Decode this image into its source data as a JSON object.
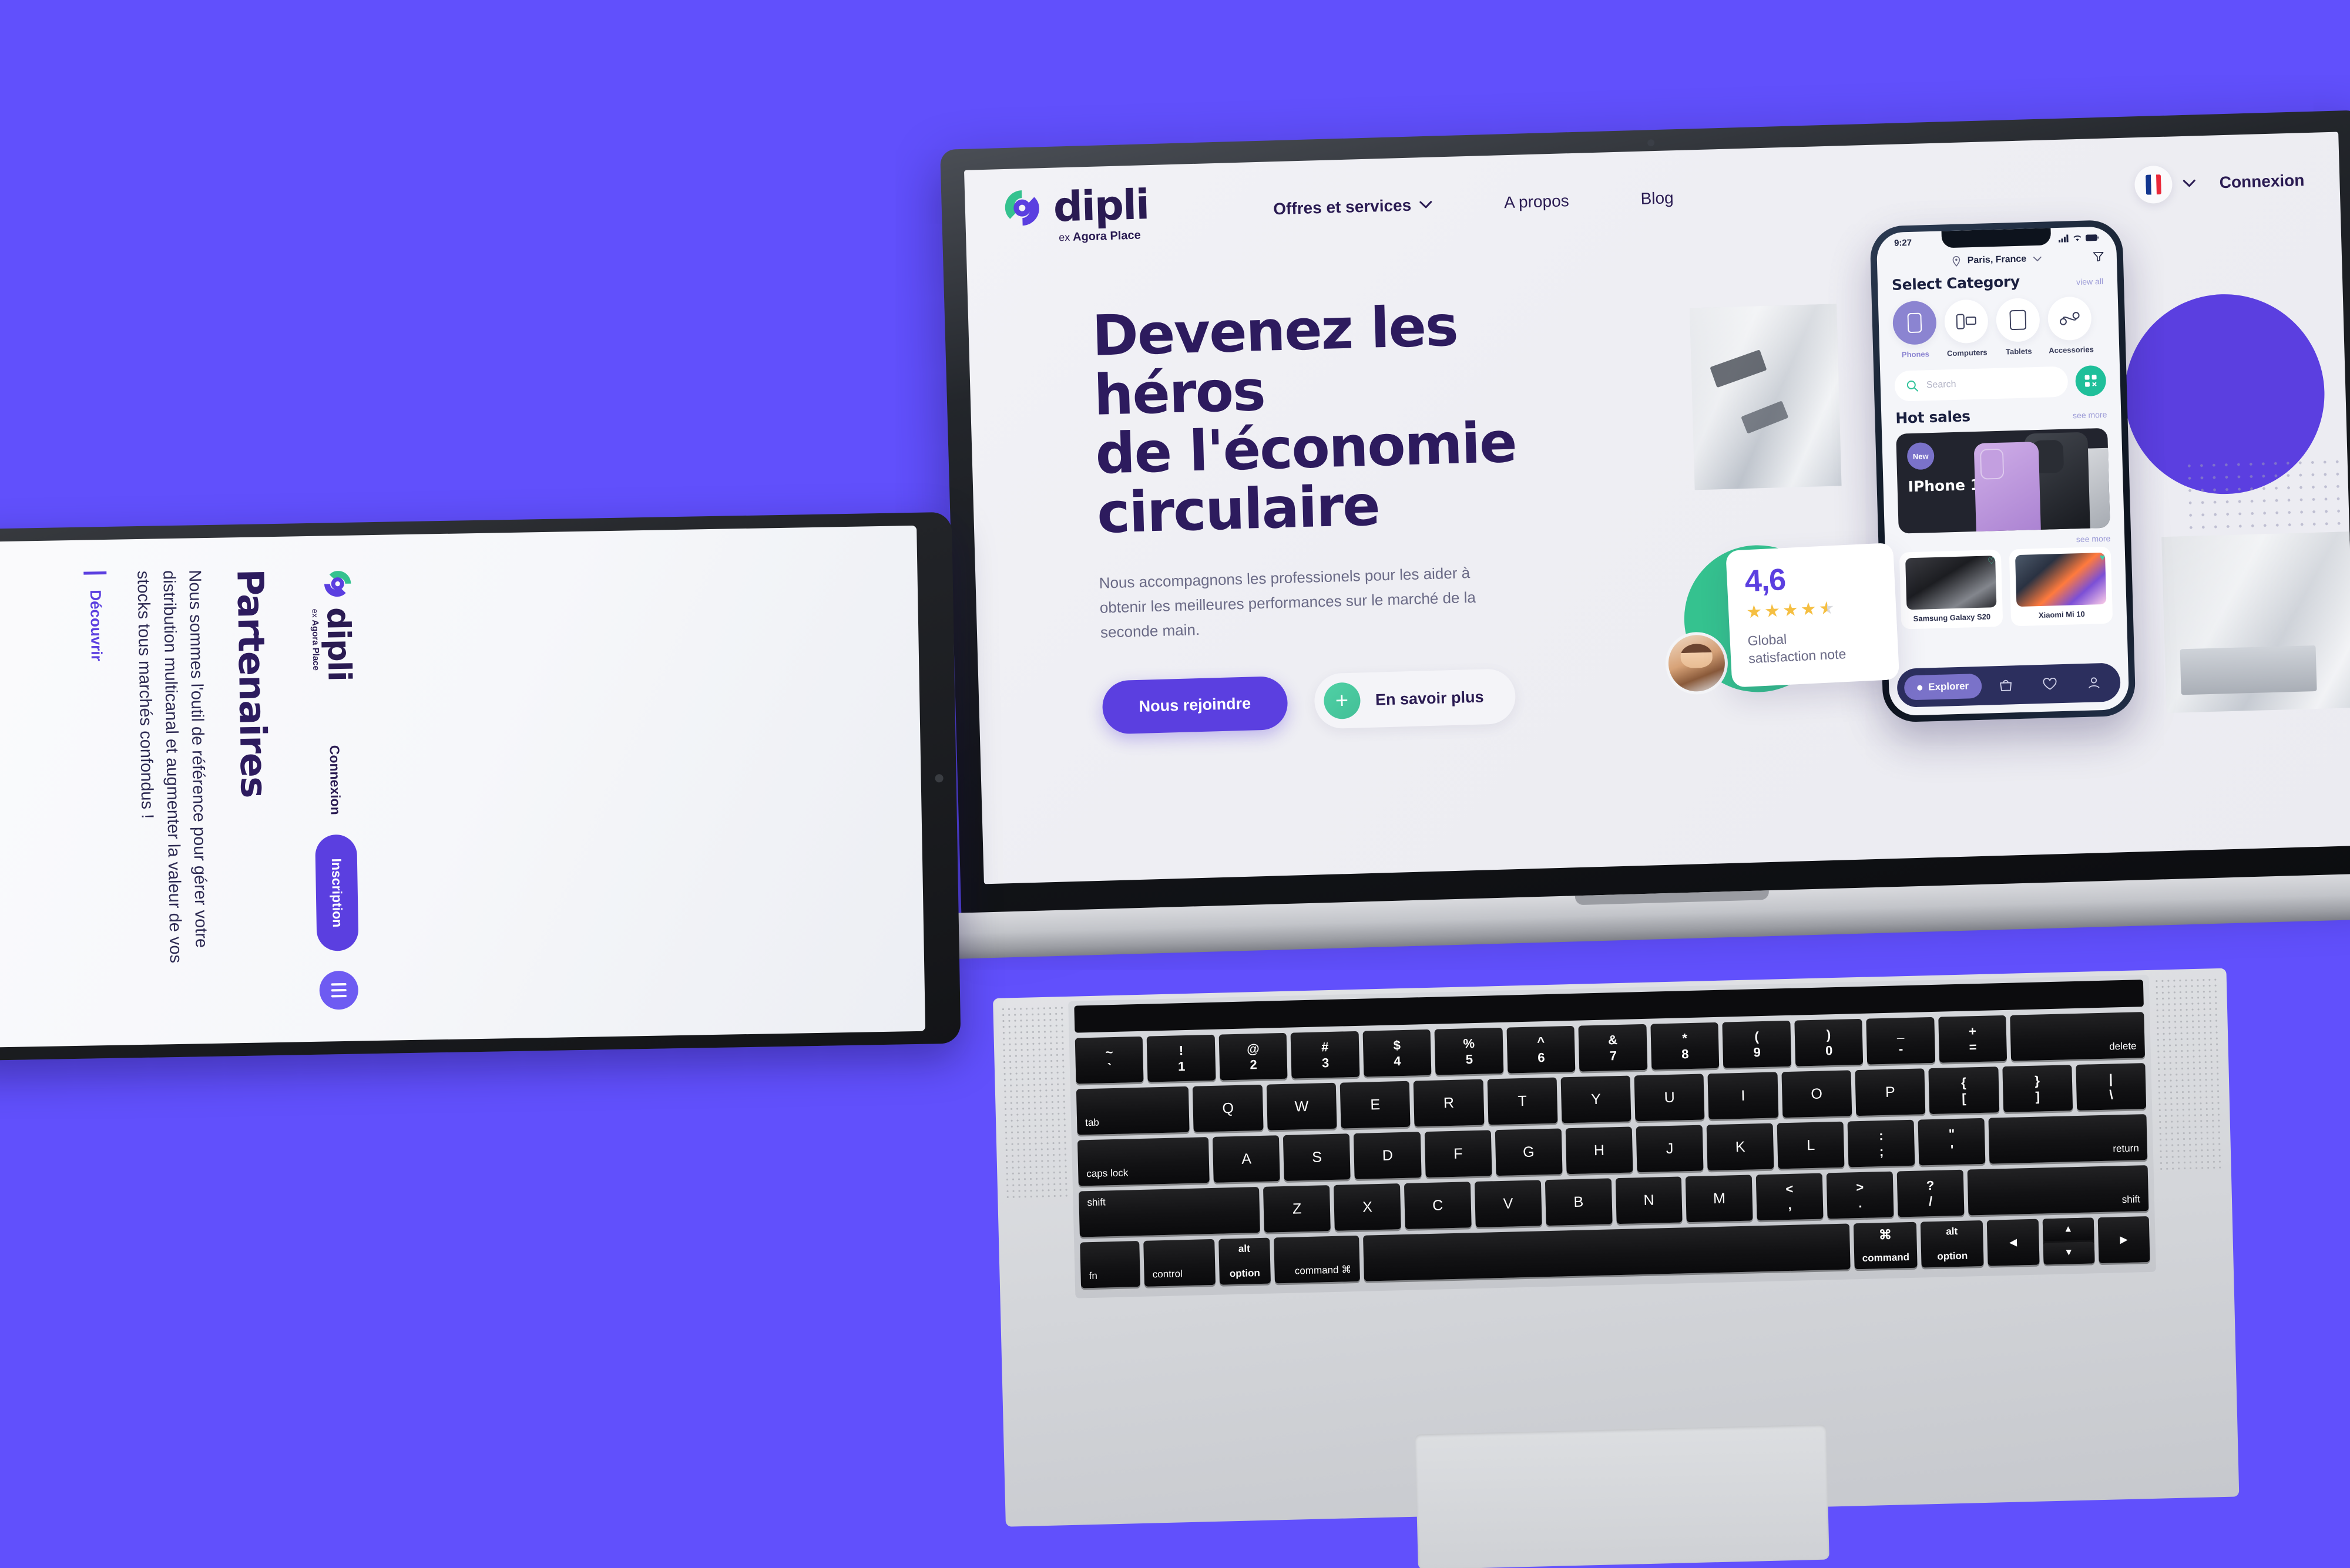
{
  "theme": {
    "background": "#6150FC",
    "brand_purple": "#5b3fe0",
    "brand_dark": "#2a1b52",
    "brand_green": "#35c28f",
    "accent_teal": "#1fbf9a",
    "star_yellow": "#f5bf42"
  },
  "desktop": {
    "brand": {
      "name": "dipli",
      "tagline_prefix": "ex",
      "tagline": "Agora Place"
    },
    "nav": [
      {
        "label": "Offres et services",
        "has_chevron": true
      },
      {
        "label": "A propos",
        "has_chevron": false
      },
      {
        "label": "Blog",
        "has_chevron": false
      }
    ],
    "language": {
      "flag": "fr-flag-icon",
      "has_chevron": true
    },
    "login_label": "Connexion",
    "hero": {
      "title_line1": "Devenez les héros",
      "title_line2": "de l'économie",
      "title_line3": "circulaire",
      "subtitle": "Nous accompagnons les professionels pour les aider à obtenir les meilleures performances sur le marché de la seconde main.",
      "primary_cta": "Nous rejoindre",
      "secondary_cta": "En savoir plus"
    },
    "rating_card": {
      "score": "4,6",
      "stars": "4.5",
      "label_line1": "Global",
      "label_line2": "satisfaction note"
    },
    "phone_app": {
      "status_time": "9:27",
      "location": "Paris, France",
      "section_title": "Select Category",
      "view_all": "view all",
      "categories": [
        {
          "label": "Phones",
          "icon": "phone-icon",
          "active": true
        },
        {
          "label": "Computers",
          "icon": "computer-icon",
          "active": false
        },
        {
          "label": "Tablets",
          "icon": "tablet-icon",
          "active": false
        },
        {
          "label": "Accessories",
          "icon": "earbuds-icon",
          "active": false
        }
      ],
      "search_placeholder": "Search",
      "hot_sales_title": "Hot sales",
      "see_more": "see more",
      "featured": {
        "badge": "New",
        "name": "IPhone 12"
      },
      "products": [
        {
          "name": "Samsung Galaxy S20"
        },
        {
          "name": "Xiaomi Mi 10"
        }
      ],
      "tabbar": {
        "active_label": "Explorer",
        "icons": [
          "bag-icon",
          "heart-icon",
          "person-icon"
        ]
      }
    }
  },
  "tablet": {
    "brand": {
      "name": "dipli",
      "tagline_prefix": "ex",
      "tagline": "Agora Place"
    },
    "login_label": "Connexion",
    "signup_label": "Inscription",
    "menu_icon": "hamburger-icon",
    "heading": "Partenaires",
    "paragraph": "Nous sommes l'outil de référence pour gérer votre distribution multicanal et augmenter la valeur de vos stocks tous marchés confondus !",
    "link_label": "Découvrir"
  },
  "keyboard": {
    "rows": [
      [
        {
          "top": "~",
          "bottom": "`"
        },
        {
          "top": "!",
          "bottom": "1"
        },
        {
          "top": "@",
          "bottom": "2"
        },
        {
          "top": "#",
          "bottom": "3"
        },
        {
          "top": "$",
          "bottom": "4"
        },
        {
          "top": "%",
          "bottom": "5"
        },
        {
          "top": "^",
          "bottom": "6"
        },
        {
          "top": "&",
          "bottom": "7"
        },
        {
          "top": "*",
          "bottom": "8"
        },
        {
          "top": "(",
          "bottom": "9"
        },
        {
          "top": ")",
          "bottom": "0"
        },
        {
          "top": "_",
          "bottom": "-"
        },
        {
          "top": "+",
          "bottom": "="
        },
        {
          "label": "delete"
        }
      ],
      [
        {
          "label": "tab"
        },
        {
          "label": "Q"
        },
        {
          "label": "W"
        },
        {
          "label": "E"
        },
        {
          "label": "R"
        },
        {
          "label": "T"
        },
        {
          "label": "Y"
        },
        {
          "label": "U"
        },
        {
          "label": "I"
        },
        {
          "label": "O"
        },
        {
          "label": "P"
        },
        {
          "top": "{",
          "bottom": "["
        },
        {
          "top": "}",
          "bottom": "]"
        },
        {
          "top": "|",
          "bottom": "\\"
        }
      ],
      [
        {
          "label": "caps lock"
        },
        {
          "label": "A"
        },
        {
          "label": "S"
        },
        {
          "label": "D"
        },
        {
          "label": "F"
        },
        {
          "label": "G"
        },
        {
          "label": "H"
        },
        {
          "label": "J"
        },
        {
          "label": "K"
        },
        {
          "label": "L"
        },
        {
          "top": ":",
          "bottom": ";"
        },
        {
          "top": "\"",
          "bottom": "'"
        },
        {
          "label": "return"
        }
      ],
      [
        {
          "label": "shift"
        },
        {
          "label": "Z"
        },
        {
          "label": "X"
        },
        {
          "label": "C"
        },
        {
          "label": "V"
        },
        {
          "label": "B"
        },
        {
          "label": "N"
        },
        {
          "label": "M"
        },
        {
          "top": "<",
          "bottom": ","
        },
        {
          "top": ">",
          "bottom": "."
        },
        {
          "top": "?",
          "bottom": "/"
        },
        {
          "label": "shift"
        }
      ],
      [
        {
          "label": "fn"
        },
        {
          "label": "control"
        },
        {
          "top": "alt",
          "bottom": "option"
        },
        {
          "top": "",
          "bottom": "command ⌘"
        },
        {
          "label": ""
        },
        {
          "top": "⌘",
          "bottom": "command"
        },
        {
          "top": "alt",
          "bottom": "option"
        },
        {
          "label": "◀"
        },
        {
          "label": "▲▼"
        },
        {
          "label": "▶"
        }
      ]
    ]
  }
}
